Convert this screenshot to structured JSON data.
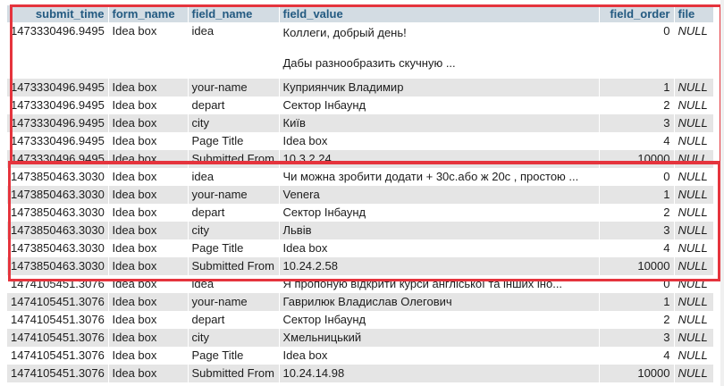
{
  "columns": [
    "submit_time",
    "form_name",
    "field_name",
    "field_value",
    "field_order",
    "file"
  ],
  "rows": [
    {
      "submit_time": "1473330496.9495",
      "form_name": "Idea box",
      "field_name": "idea",
      "field_value": "Коллеги, добрый день!\n\nДабы разнообразить скучную ...",
      "field_order": "0",
      "file": "NULL"
    },
    {
      "submit_time": "1473330496.9495",
      "form_name": "Idea box",
      "field_name": "your-name",
      "field_value": "Куприянчик Владимир",
      "field_order": "1",
      "file": "NULL"
    },
    {
      "submit_time": "1473330496.9495",
      "form_name": "Idea box",
      "field_name": "depart",
      "field_value": "Сектор Інбаунд",
      "field_order": "2",
      "file": "NULL"
    },
    {
      "submit_time": "1473330496.9495",
      "form_name": "Idea box",
      "field_name": "city",
      "field_value": "Київ",
      "field_order": "3",
      "file": "NULL"
    },
    {
      "submit_time": "1473330496.9495",
      "form_name": "Idea box",
      "field_name": "Page Title",
      "field_value": "Idea box",
      "field_order": "4",
      "file": "NULL"
    },
    {
      "submit_time": "1473330496.9495",
      "form_name": "Idea box",
      "field_name": "Submitted From",
      "field_value": "10.3.2.24",
      "field_order": "10000",
      "file": "NULL"
    },
    {
      "submit_time": "1473850463.3030",
      "form_name": "Idea box",
      "field_name": "idea",
      "field_value": "Чи можна зробити додати + 30с.або ж 20с , простою ...",
      "field_order": "0",
      "file": "NULL"
    },
    {
      "submit_time": "1473850463.3030",
      "form_name": "Idea box",
      "field_name": "your-name",
      "field_value": "Venera",
      "field_order": "1",
      "file": "NULL"
    },
    {
      "submit_time": "1473850463.3030",
      "form_name": "Idea box",
      "field_name": "depart",
      "field_value": "Сектор Інбаунд",
      "field_order": "2",
      "file": "NULL"
    },
    {
      "submit_time": "1473850463.3030",
      "form_name": "Idea box",
      "field_name": "city",
      "field_value": "Львів",
      "field_order": "3",
      "file": "NULL"
    },
    {
      "submit_time": "1473850463.3030",
      "form_name": "Idea box",
      "field_name": "Page Title",
      "field_value": "Idea box",
      "field_order": "4",
      "file": "NULL"
    },
    {
      "submit_time": "1473850463.3030",
      "form_name": "Idea box",
      "field_name": "Submitted From",
      "field_value": "10.24.2.58",
      "field_order": "10000",
      "file": "NULL"
    },
    {
      "submit_time": "1474105451.3076",
      "form_name": "Idea box",
      "field_name": "idea",
      "field_value": "Я пропоную відкрити курси англіської та інших іно...",
      "field_order": "0",
      "file": "NULL"
    },
    {
      "submit_time": "1474105451.3076",
      "form_name": "Idea box",
      "field_name": "your-name",
      "field_value": "Гаврилюк Владислав Олегович",
      "field_order": "1",
      "file": "NULL"
    },
    {
      "submit_time": "1474105451.3076",
      "form_name": "Idea box",
      "field_name": "depart",
      "field_value": "Сектор Інбаунд",
      "field_order": "2",
      "file": "NULL"
    },
    {
      "submit_time": "1474105451.3076",
      "form_name": "Idea box",
      "field_name": "city",
      "field_value": "Хмельницький",
      "field_order": "3",
      "file": "NULL"
    },
    {
      "submit_time": "1474105451.3076",
      "form_name": "Idea box",
      "field_name": "Page Title",
      "field_value": "Idea box",
      "field_order": "4",
      "file": "NULL"
    },
    {
      "submit_time": "1474105451.3076",
      "form_name": "Idea box",
      "field_name": "Submitted From",
      "field_value": "10.24.14.98",
      "field_order": "10000",
      "file": "NULL"
    }
  ],
  "colors": {
    "header_bg": "#d3dce3",
    "header_text": "#235a81",
    "row_odd": "#ffffff",
    "row_even": "#e5e5e5",
    "highlight_border": "#e5343d"
  }
}
